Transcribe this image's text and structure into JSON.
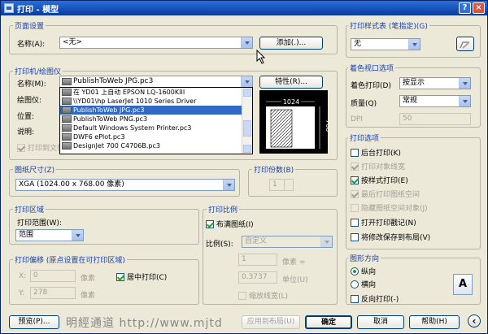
{
  "title": "打印 - 模型",
  "titlebar_buttons": {
    "help": "?",
    "close": "×"
  },
  "page_setup": {
    "group": "页面设置",
    "name_label": "名称(A):",
    "name_value": "<无>",
    "add_button": "添加(.)..."
  },
  "printer": {
    "group": "打印机/绘图仪",
    "name_label": "名称(M):",
    "name_value": "PublishToWeb JPG.pc3",
    "properties_button": "特性(R)...",
    "plotter_label": "绘图仪:",
    "location_label": "位置:",
    "description_label": "说明:",
    "print_to_file": "打印到文件",
    "dropdown_items": [
      "在 YD01 上自动 EPSON LQ-1600KIII",
      "\\\\YD01\\hp LaserJet 1010 Series Driver",
      "PublishToWeb JPG.pc3",
      "PublishToWeb PNG.pc3",
      "Default Windows System Printer.pc3",
      "DWF6 ePlot.pc3",
      "DesignJet 700 C4706B.pc3"
    ],
    "dropdown_selected": 2,
    "preview_width": "1024",
    "preview_height": "768"
  },
  "paper_size": {
    "group": "图纸尺寸(Z)",
    "value": "XGA (1024.00 x 768.00 像素)"
  },
  "copies": {
    "group": "打印份数(B)",
    "value": "1"
  },
  "plot_area": {
    "group": "打印区域",
    "range_label": "打印范围(W):",
    "range_value": "范围"
  },
  "plot_offset": {
    "group": "打印偏移 (原点设置在可打印区域)",
    "x_label": "X:",
    "x_value": "0",
    "x_unit": "像素",
    "y_label": "Y:",
    "y_value": "278",
    "y_unit": "像素",
    "center": "居中打印(C)"
  },
  "plot_scale": {
    "group": "打印比例",
    "fit": "布满图纸(I)",
    "scale_label": "比例(S):",
    "scale_value": "自定义",
    "val1": "1",
    "unit1": "像素 =",
    "val2": "0.3737",
    "unit2": "单位(U)",
    "lineweights": "缩放线宽(L)"
  },
  "plot_style": {
    "group": "打印样式表 (笔指定)(G)",
    "value": "无"
  },
  "shaded_viewport": {
    "group": "着色视口选项",
    "shade_label": "着色打印(D)",
    "shade_value": "按显示",
    "quality_label": "质量(Q)",
    "quality_value": "常规",
    "dpi_label": "DPI",
    "dpi_value": "50"
  },
  "plot_options": {
    "group": "打印选项",
    "items": [
      {
        "label": "后台打印(K)",
        "checked": false,
        "disabled": false
      },
      {
        "label": "打印对象线宽",
        "checked": true,
        "disabled": true
      },
      {
        "label": "按样式打印(E)",
        "checked": true,
        "disabled": false
      },
      {
        "label": "最后打印图纸空间",
        "checked": true,
        "disabled": true
      },
      {
        "label": "隐藏图纸空间对象(J)",
        "checked": false,
        "disabled": true
      },
      {
        "label": "打开打印戳记(N)",
        "checked": false,
        "disabled": false
      },
      {
        "label": "将修改保存到布局(V)",
        "checked": false,
        "disabled": false
      }
    ]
  },
  "orientation": {
    "group": "图形方向",
    "portrait": "纵向",
    "landscape": "横向",
    "upside_down": "反向打印(-)",
    "icon_letter": "A"
  },
  "footer": {
    "preview": "预览(P)...",
    "apply": "应用到布局(U)",
    "ok": "确定",
    "cancel": "取消",
    "help": "帮助(H)",
    "more": "‹"
  },
  "watermark": "明經通道 http://www.mjtd"
}
